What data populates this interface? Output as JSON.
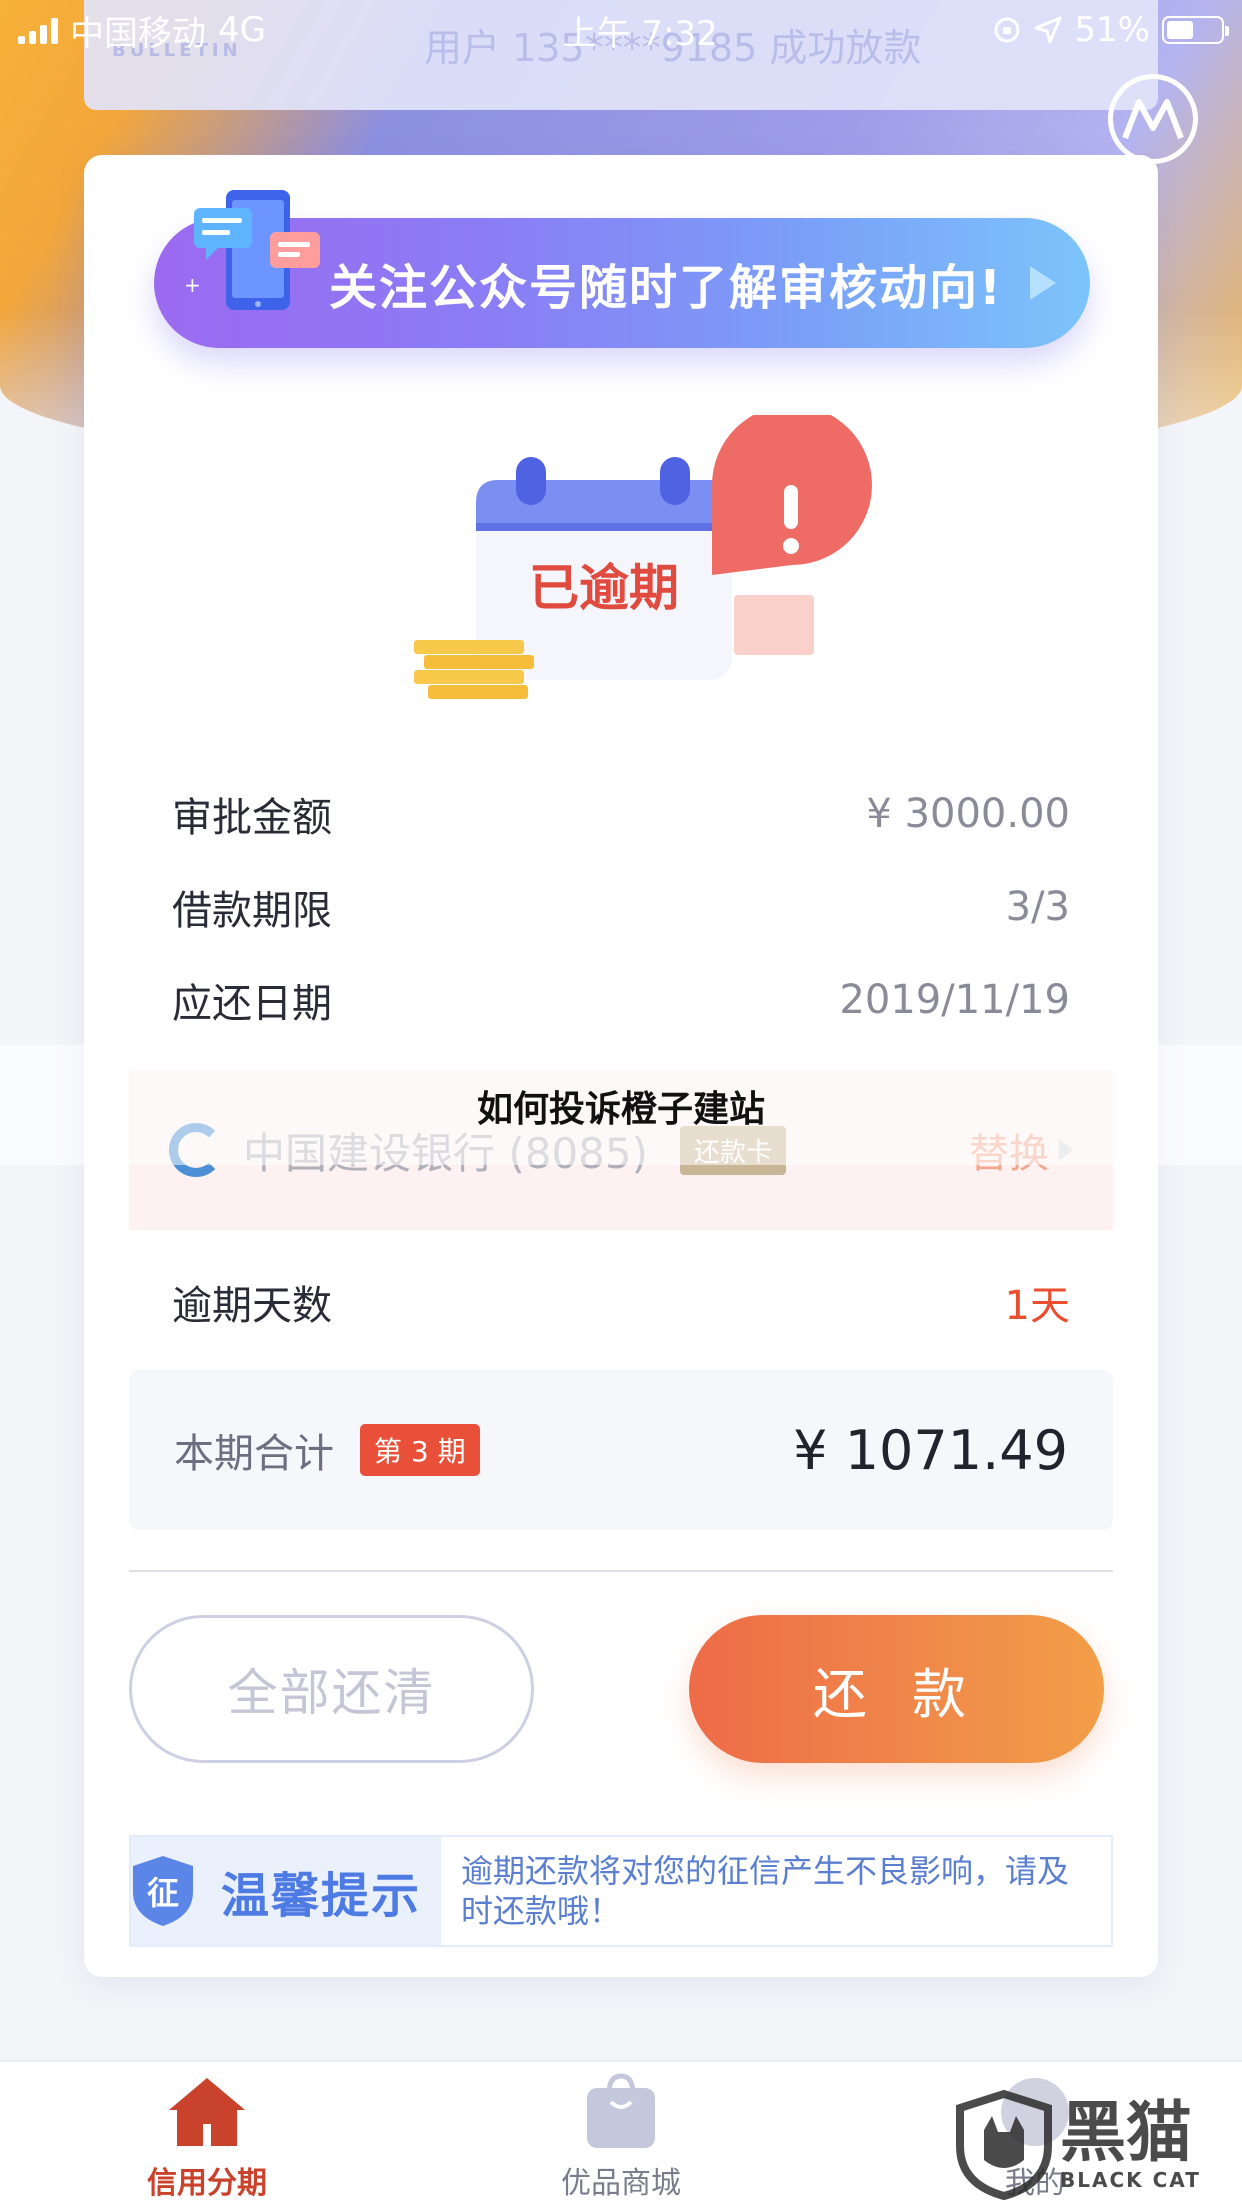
{
  "status_bar": {
    "carrier": "中国移动",
    "network": "4G",
    "time": "上午 7:32",
    "battery": "51%"
  },
  "bulletin": {
    "tag": "BULLETIN",
    "text": "用户 135****9185 成功放款"
  },
  "banner": {
    "text": "关注公众号随时了解审核动向!"
  },
  "overdue_badge": {
    "text": "已逾期"
  },
  "info": {
    "approved_amount_label": "审批金额",
    "approved_amount_value": "¥ 3000.00",
    "loan_term_label": "借款期限",
    "loan_term_value": "3/3",
    "due_date_label": "应还日期",
    "due_date_value": "2019/11/19",
    "overdue_days_label": "逾期天数",
    "overdue_days_value": "1天"
  },
  "bank": {
    "name": "中国建设银行 (8085)",
    "tag": "还款卡",
    "switch_label": "替换"
  },
  "watermark_title": "如何投诉橙子建站",
  "total": {
    "label": "本期合计",
    "period_badge": "第 3 期",
    "amount": "¥ 1071.49"
  },
  "buttons": {
    "pay_all": "全部还清",
    "repay": "还 款"
  },
  "tip": {
    "badge_char": "征",
    "title": "温馨提示",
    "body": "逾期还款将对您的征信产生不良影响，请及时还款哦！"
  },
  "tabbar": {
    "tabs": [
      {
        "label": "信用分期",
        "active": true
      },
      {
        "label": "优品商城",
        "active": false
      },
      {
        "label": "我的",
        "active": false
      }
    ]
  },
  "brand_watermark": {
    "cn": "黑猫",
    "en": "BLACK CAT"
  },
  "colors": {
    "accent_orange": "#ee6b48",
    "overdue_red": "#e94f2f",
    "banner_purple": "#9b6af0",
    "tip_blue": "#4e7be3"
  }
}
